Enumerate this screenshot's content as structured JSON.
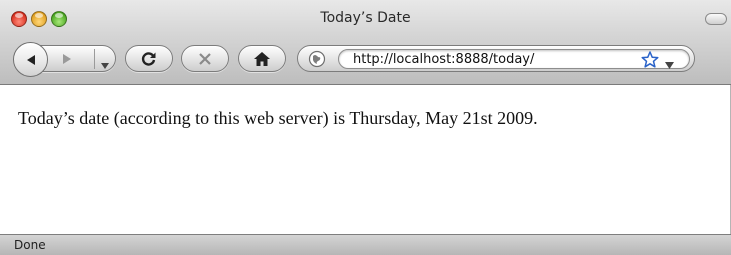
{
  "window": {
    "title": "Today’s Date"
  },
  "toolbar": {
    "back_icon": "back-arrow-icon",
    "forward_icon": "forward-arrow-icon",
    "history_dropdown_icon": "chevron-down-icon",
    "reload_icon": "reload-icon",
    "stop_icon": "stop-x-icon",
    "home_icon": "home-icon"
  },
  "address_bar": {
    "site_icon": "globe-icon",
    "url": "http://localhost:8888/today/",
    "bookmark_icon": "star-icon",
    "menu_icon": "triangle-down-icon"
  },
  "page": {
    "text": "Today’s date (according to this web server) is Thursday, May 21st 2009."
  },
  "status_bar": {
    "text": "Done"
  },
  "colors": {
    "close": "#d8301f",
    "minimize": "#e0a021",
    "zoom": "#4ca822",
    "bookmark_star": "#2a63c9"
  }
}
